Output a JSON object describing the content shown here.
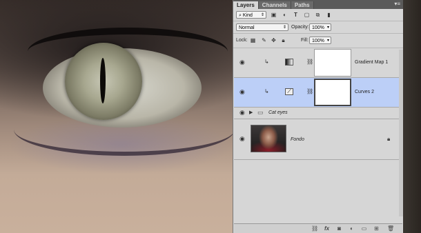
{
  "panel": {
    "tabs": [
      {
        "label": "Layers"
      },
      {
        "label": "Channels"
      },
      {
        "label": "Paths"
      }
    ],
    "menu_icon": "panel-menu-icon",
    "filter": {
      "value": "Kind",
      "icons": [
        "image-filter-icon",
        "adjustment-filter-icon",
        "text-filter-icon",
        "shape-filter-icon",
        "smart-object-filter-icon",
        "filter-toggle-icon"
      ]
    },
    "blend_mode": {
      "value": "Normal"
    },
    "opacity": {
      "label": "Opacity:",
      "value": "100%"
    },
    "lock": {
      "label": "Lock:"
    },
    "fill": {
      "label": "Fill:",
      "value": "100%"
    },
    "layers": [
      {
        "name": "Gradient Map 1",
        "selected": false
      },
      {
        "name": "Curves 2",
        "selected": true
      },
      {
        "name": "Cat eyes"
      },
      {
        "name": "Fondo",
        "locked": true
      }
    ],
    "bottom_icons": [
      "link-icon",
      "fx-icon",
      "mask-icon",
      "adjustment-icon",
      "folder-icon",
      "new-layer-icon",
      "trash-icon"
    ],
    "fx_label": "fx"
  },
  "colors": {
    "selected_row": "#bccff7",
    "panel_bg": "#d6d6d6"
  }
}
